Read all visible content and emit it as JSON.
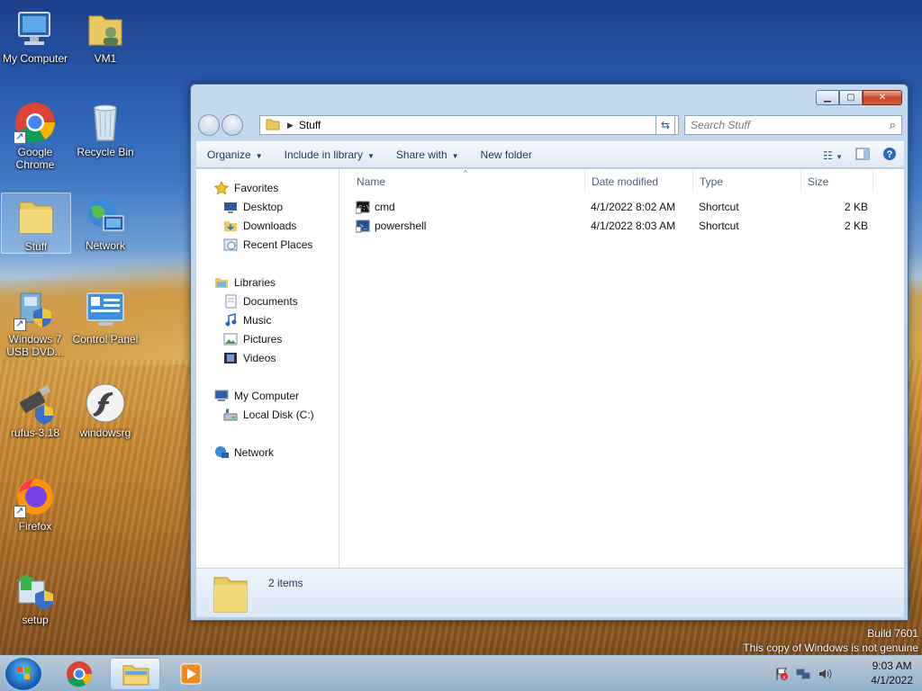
{
  "desktop": {
    "icons": [
      {
        "label": "My Computer"
      },
      {
        "label": "VM1"
      },
      {
        "label": "Google Chrome"
      },
      {
        "label": "Recycle Bin"
      },
      {
        "label": "Stuff"
      },
      {
        "label": "Network"
      },
      {
        "label": "Windows 7 USB DVD..."
      },
      {
        "label": "Control Panel"
      },
      {
        "label": "rufus-3.18"
      },
      {
        "label": "windowsrg"
      },
      {
        "label": "Firefox"
      },
      {
        "label": "setup"
      }
    ],
    "watermark": {
      "build": "Build 7601",
      "notice": "This copy of Windows is not genuine"
    }
  },
  "window": {
    "address": {
      "crumb": "Stuff"
    },
    "search": {
      "placeholder": "Search Stuff"
    },
    "toolbar": {
      "organize": "Organize",
      "include": "Include in library",
      "share": "Share with",
      "new_folder": "New folder"
    },
    "nav": {
      "favorites": "Favorites",
      "desktop": "Desktop",
      "downloads": "Downloads",
      "recent": "Recent Places",
      "libraries": "Libraries",
      "documents": "Documents",
      "music": "Music",
      "pictures": "Pictures",
      "videos": "Videos",
      "computer": "My Computer",
      "local_disk": "Local Disk (C:)",
      "network": "Network"
    },
    "columns": {
      "name": "Name",
      "date": "Date modified",
      "type": "Type",
      "size": "Size"
    },
    "files": [
      {
        "name": "cmd",
        "date": "4/1/2022 8:02 AM",
        "type": "Shortcut",
        "size": "2 KB"
      },
      {
        "name": "powershell",
        "date": "4/1/2022 8:03 AM",
        "type": "Shortcut",
        "size": "2 KB"
      }
    ],
    "status": {
      "count": "2 items"
    }
  },
  "taskbar": {
    "time": "9:03 AM",
    "date": "4/1/2022"
  },
  "colors": {
    "accent": "#1e395b",
    "selection": "#e4eef9"
  }
}
